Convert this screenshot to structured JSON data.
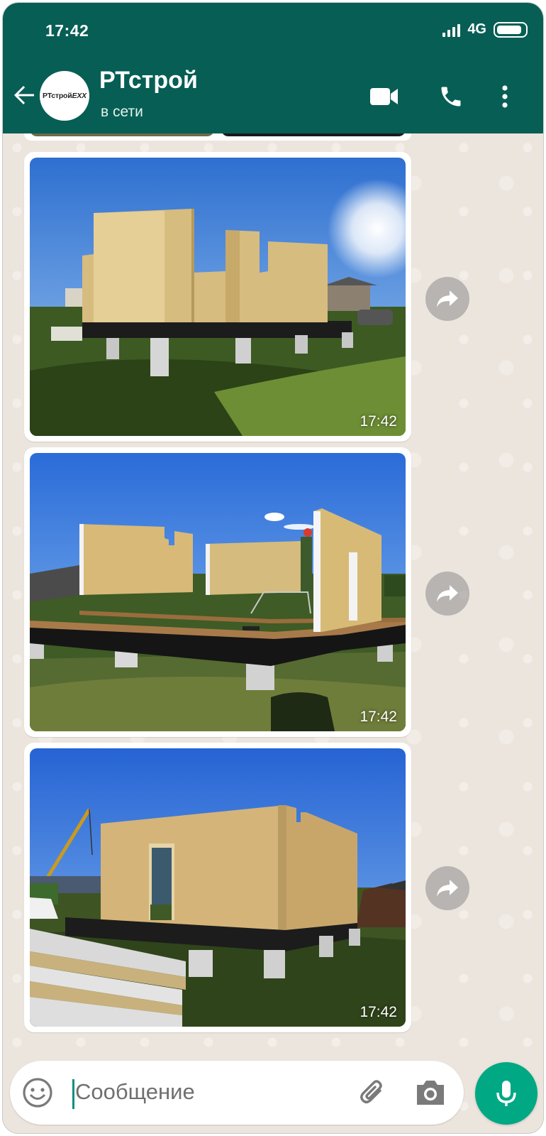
{
  "status_bar": {
    "time": "17:42",
    "network": "4G",
    "battery_level": 0.9
  },
  "header": {
    "title": "РТстрой",
    "subtitle": "в сети",
    "avatar_text": "РТстрой",
    "avatar_suffix": "ЕХХ",
    "actions": [
      "video-call-icon",
      "voice-call-icon",
      "more-vert-icon"
    ]
  },
  "messages": [
    {
      "type": "image",
      "time": "17:42",
      "icon": "forward-icon"
    },
    {
      "type": "image",
      "time": "17:42",
      "icon": "forward-icon"
    },
    {
      "type": "image",
      "time": "17:42",
      "icon": "forward-icon"
    }
  ],
  "input": {
    "placeholder": "Сообщение"
  },
  "colors": {
    "header": "#075e54",
    "accent": "#00a884",
    "chat_bg": "#ece5dd"
  }
}
